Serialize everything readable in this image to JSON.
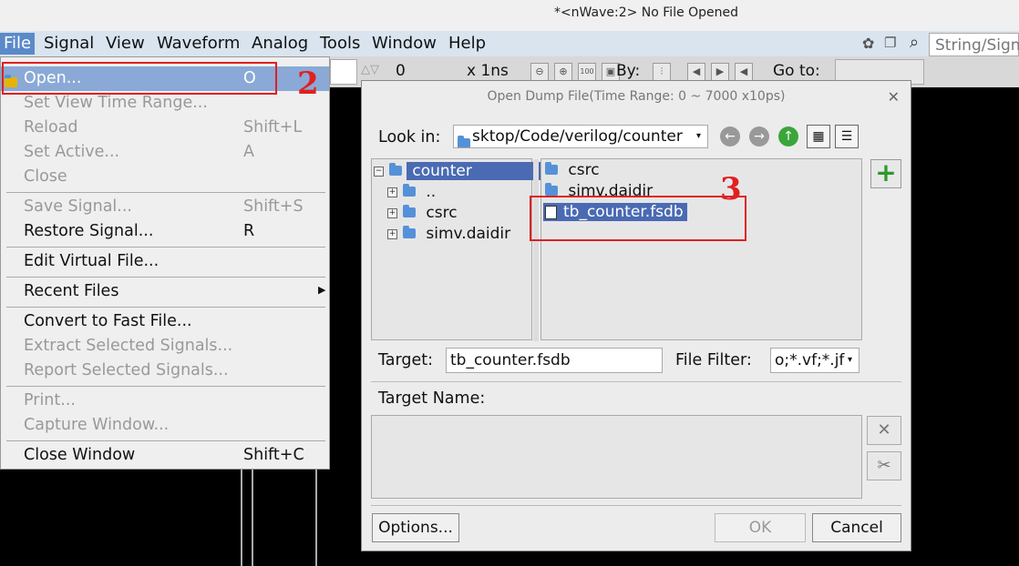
{
  "window": {
    "title": "*<nWave:2> No File Opened"
  },
  "menubar": {
    "items": [
      "File",
      "Signal",
      "View",
      "Waveform",
      "Analog",
      "Tools",
      "Window",
      "Help"
    ]
  },
  "toolbar": {
    "time_value": "0",
    "unit": "x 1ns",
    "by_label": "By:",
    "goto_label": "Go to:",
    "zoom_label": "100"
  },
  "search": {
    "placeholder": "String/Signal"
  },
  "file_menu": {
    "items": [
      {
        "label": "Open...",
        "accel": "O",
        "enabled": true,
        "highlighted": true
      },
      {
        "label": "Set View Time Range...",
        "accel": "",
        "enabled": false
      },
      {
        "label": "Reload",
        "accel": "Shift+L",
        "enabled": false
      },
      {
        "label": "Set Active...",
        "accel": "A",
        "enabled": false
      },
      {
        "label": "Close",
        "accel": "",
        "enabled": false
      },
      {
        "label": "Save Signal...",
        "accel": "Shift+S",
        "enabled": false
      },
      {
        "label": "Restore Signal...",
        "accel": "R",
        "enabled": true
      },
      {
        "label": "Edit Virtual File...",
        "accel": "",
        "enabled": true
      },
      {
        "label": "Recent Files",
        "accel": "",
        "enabled": true
      },
      {
        "label": "Convert to Fast File...",
        "accel": "",
        "enabled": true
      },
      {
        "label": "Extract Selected Signals...",
        "accel": "",
        "enabled": false
      },
      {
        "label": "Report Selected Signals...",
        "accel": "",
        "enabled": false
      },
      {
        "label": "Print...",
        "accel": "",
        "enabled": false
      },
      {
        "label": "Capture Window...",
        "accel": "",
        "enabled": false
      },
      {
        "label": "Close Window",
        "accel": "Shift+C",
        "enabled": true
      }
    ]
  },
  "dialog": {
    "title": "Open Dump File(Time Range: 0 ~ 7000 x10ps)",
    "look_in_label": "Look in:",
    "look_in_value": "sktop/Code/verilog/counter",
    "tree": [
      {
        "label": "counter",
        "selected": true
      },
      {
        "label": ".."
      },
      {
        "label": "csrc"
      },
      {
        "label": "simv.daidir"
      }
    ],
    "files": [
      {
        "label": "csrc",
        "type": "folder"
      },
      {
        "label": "simv.daidir",
        "type": "folder"
      },
      {
        "label": "tb_counter.fsdb",
        "type": "file",
        "selected": true
      }
    ],
    "target_label": "Target:",
    "target_value": "tb_counter.fsdb",
    "filter_label": "File Filter:",
    "filter_value": "o;*.vf;*.jf",
    "target_name_label": "Target Name:",
    "options_button": "Options...",
    "ok_button": "OK",
    "cancel_button": "Cancel"
  },
  "annotations": {
    "step2": "2",
    "step3": "3"
  },
  "colors": {
    "accent": "#4a6bb3",
    "annotation": "#e02020",
    "menubar": "#d9e4ef"
  }
}
